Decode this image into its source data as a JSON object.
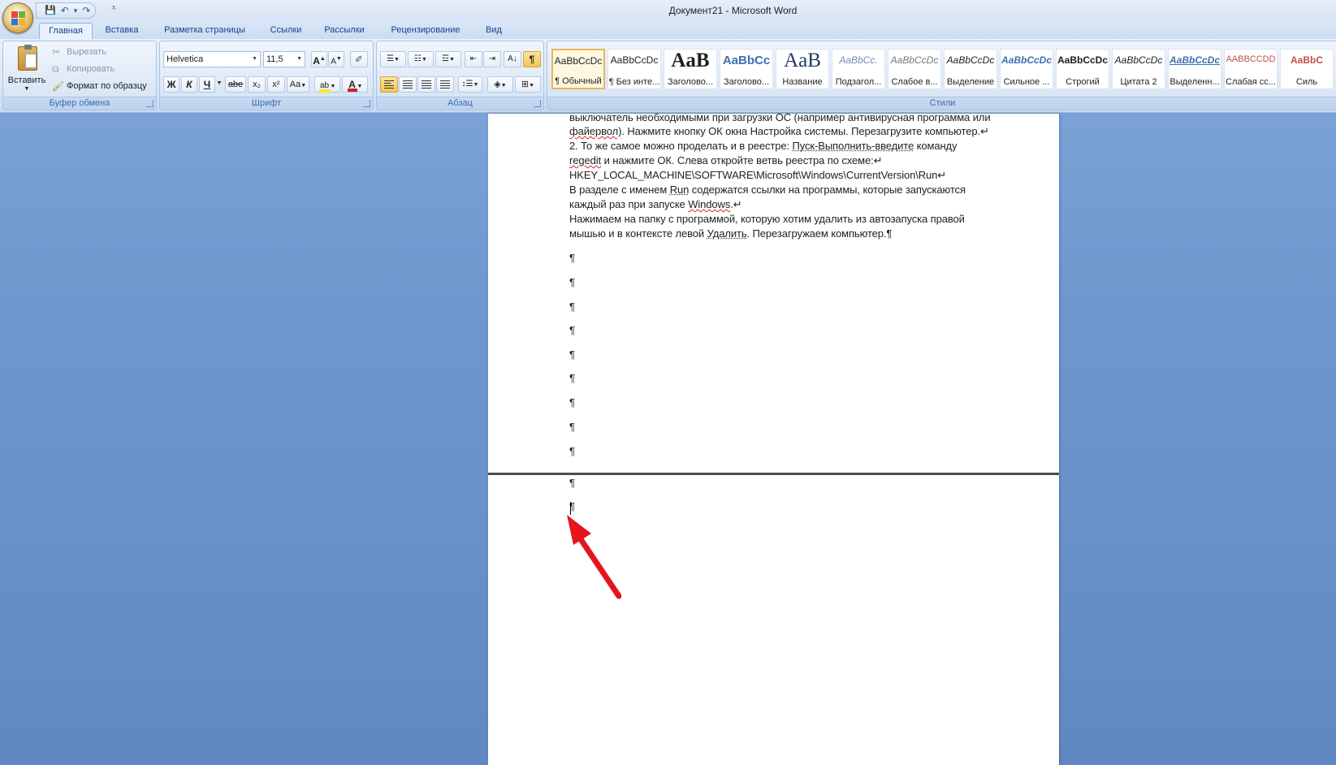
{
  "window": {
    "title": "Документ21 - Microsoft Word"
  },
  "qat": {
    "save": "💾",
    "undo": "↶",
    "undo_dd": "▾",
    "redo": "↷",
    "more": "⩡"
  },
  "tabs": [
    "Главная",
    "Вставка",
    "Разметка страницы",
    "Ссылки",
    "Рассылки",
    "Рецензирование",
    "Вид"
  ],
  "clipboard": {
    "paste": "Вставить",
    "cut": "Вырезать",
    "copy": "Копировать",
    "format_painter": "Формат по образцу",
    "group": "Буфер обмена"
  },
  "font": {
    "name": "Helvetica",
    "size": "11,5",
    "bold": "Ж",
    "italic": "К",
    "underline": "Ч",
    "strike": "abe",
    "sub": "x₂",
    "sup": "x²",
    "case": "Aa",
    "grow": "A",
    "shrink": "A",
    "group": "Шрифт"
  },
  "paragraph": {
    "pilcrow": "¶",
    "group": "Абзац"
  },
  "styles": {
    "group": "Стили",
    "items": [
      {
        "preview": "AaBbCcDc",
        "name": "¶ Обычный"
      },
      {
        "preview": "AaBbCcDc",
        "name": "¶ Без инте..."
      },
      {
        "preview": "AaB",
        "name": "Заголово..."
      },
      {
        "preview": "AaBbCc",
        "name": "Заголово..."
      },
      {
        "preview": "AaB",
        "name": "Название"
      },
      {
        "preview": "AaBbCc.",
        "name": "Подзагол..."
      },
      {
        "preview": "AaBbCcDc",
        "name": "Слабое в..."
      },
      {
        "preview": "AaBbCcDc",
        "name": "Выделение"
      },
      {
        "preview": "AaBbCcDc",
        "name": "Сильное ..."
      },
      {
        "preview": "AaBbCcDc",
        "name": "Строгий"
      },
      {
        "preview": "AaBbCcDc",
        "name": "Цитата 2"
      },
      {
        "preview": "AaBbCcDc",
        "name": "Выделенн..."
      },
      {
        "preview": "AABBCCDD",
        "name": "Слабая сс..."
      },
      {
        "preview": "AaBbC",
        "name": "Силь"
      }
    ]
  },
  "document": {
    "lines": [
      "выключатель необходимыми при загрузки ОС (например антивирусная программа или",
      "файервол).  Нажмите кнопку ОК окна Настройка системы. Перезагрузите компьютер.↵",
      "2. То же самое можно проделать и в реестре: Пуск-Выполнить-введите команду",
      "regedit и нажмите ОК. Слева откройте ветвь реестра по схеме:↵",
      "HKEY_LOCAL_MACHINE\\SOFTWARE\\Microsoft\\Windows\\CurrentVersion\\Run↵",
      "В разделе с именем Run содержатся ссылки на программы, которые запускаются",
      "каждый раз при запуске Windows.↵",
      "Нажимаем на папку с программой, которую хотим удалить из автозапуска правой",
      "мышью и в контексте левой Удалить. Перезагружаем компьютер.¶"
    ],
    "pilcrow": "¶"
  },
  "colors": {
    "arrow": "#e5151b",
    "selected_style": "#e9b654"
  }
}
